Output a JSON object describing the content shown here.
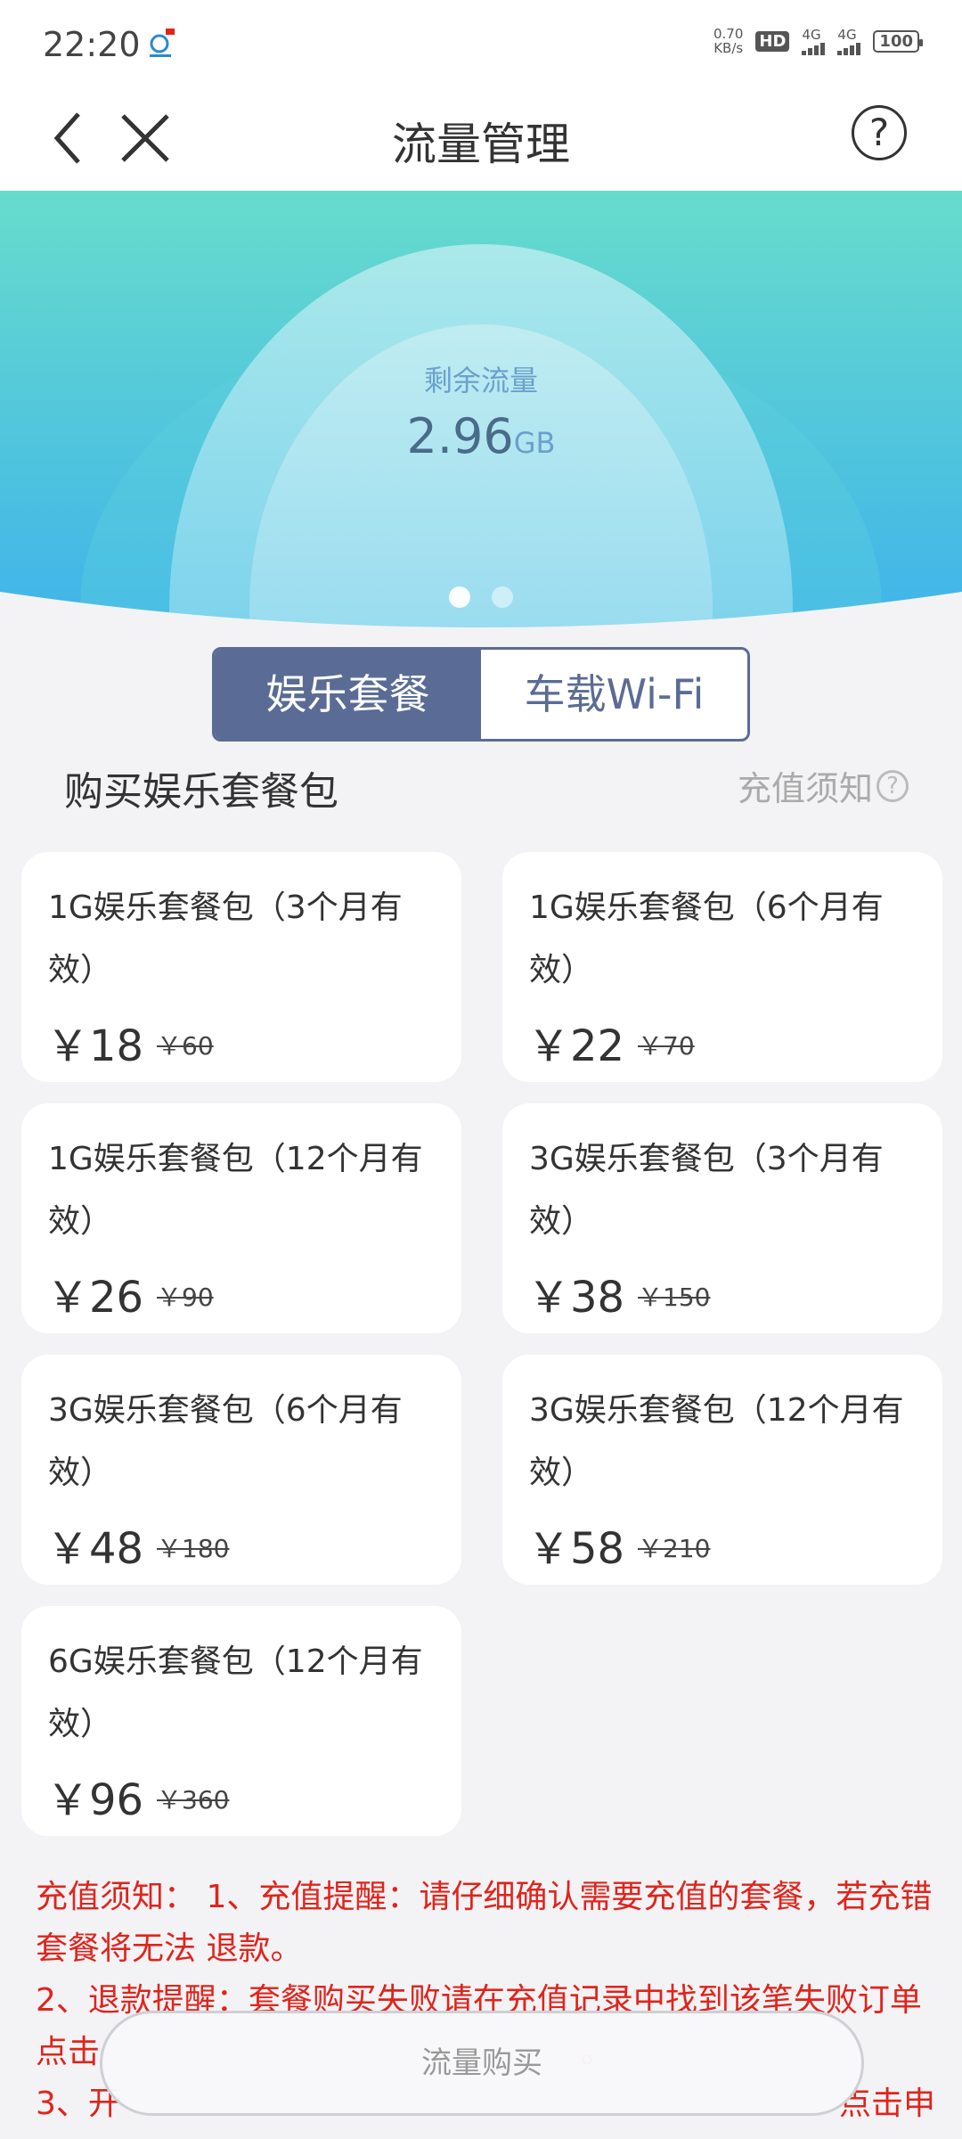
{
  "status_bar": {
    "time": "22:20",
    "net_speed_value": "0.70",
    "net_speed_unit": "KB/s",
    "hd_label": "HD",
    "sim1_label": "4G",
    "sim2_label": "4G",
    "battery": "100"
  },
  "title_bar": {
    "title": "流量管理",
    "help_glyph": "?"
  },
  "hero": {
    "label": "剩余流量",
    "value": "2.96",
    "unit": "GB",
    "pager": {
      "count": 2,
      "active_index": 0
    }
  },
  "tabs": [
    {
      "label": "娱乐套餐",
      "active": true
    },
    {
      "label": "车载Wi-Fi",
      "active": false
    }
  ],
  "section": {
    "title": "购买娱乐套餐包",
    "notice_link": "充值须知",
    "notice_icon": "?"
  },
  "packages": [
    {
      "name": "1G娱乐套餐包（3个月有效）",
      "price": "￥18",
      "original": "￥60"
    },
    {
      "name": "1G娱乐套餐包（6个月有效）",
      "price": "￥22",
      "original": "￥70"
    },
    {
      "name": "1G娱乐套餐包（12个月有效）",
      "price": "￥26",
      "original": "￥90"
    },
    {
      "name": "3G娱乐套餐包（3个月有效）",
      "price": "￥38",
      "original": "￥150"
    },
    {
      "name": "3G娱乐套餐包（6个月有效）",
      "price": "￥48",
      "original": "￥180"
    },
    {
      "name": "3G娱乐套餐包（12个月有效）",
      "price": "￥58",
      "original": "￥210"
    },
    {
      "name": "6G娱乐套餐包（12个月有效）",
      "price": "￥96",
      "original": "￥360"
    }
  ],
  "notice": {
    "line1": "充值须知： 1、充值提醒：请仔细确认需要充值的套餐，若充错套餐将无法 退款。",
    "line2": "2、退款提醒：套餐购买失败请在充值记录中找到该笔失败订单点击",
    "line2_tail": "。",
    "line3_start": "3、开",
    "line3_end": "点击申"
  },
  "buy_button": {
    "label": "流量购买"
  },
  "colors": {
    "accent": "#5a6c95",
    "notice_red": "#e0241b",
    "hero_top": "#67dccc",
    "hero_bottom": "#3fb3ea"
  }
}
